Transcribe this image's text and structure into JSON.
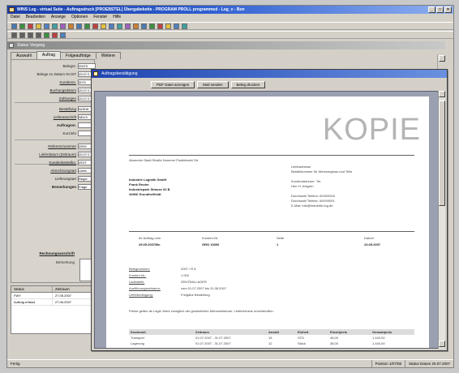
{
  "app": {
    "title": "WINS Log - virtual Suite - Auftragsdruck [PROEBSTEL] Übergabekette - PROGRAM PROLL programmed - Log_v - Bon",
    "menu": [
      "Datei",
      "Bearbeiten",
      "Anzeige",
      "Optionen",
      "Fenster",
      "Hilfe"
    ]
  },
  "doc_window": {
    "title": "Status Vorgang",
    "tabs": [
      "Auswahl",
      "Auftrag",
      "Folgeaufträge",
      "Weitere"
    ],
    "active_tab": 1
  },
  "form": {
    "fields": [
      {
        "label": "Belegnr.",
        "value": "20070",
        "style": "normal"
      },
      {
        "label": "Belege zu Datum IN IST",
        "value": "29.07.0",
        "style": "normal"
      },
      {
        "label": "Kundennr.",
        "value": "3070",
        "style": "link"
      },
      {
        "label": "Buchungsdatum",
        "value": "20.07.0",
        "style": "link"
      },
      {
        "label": "Zahlungen",
        "value": "20.07.0",
        "style": "link"
      },
      {
        "label": "Bestellung",
        "value": "NOEW",
        "style": "link"
      },
      {
        "label": "Lieferanschrift",
        "value": "NEU3",
        "style": "link"
      },
      {
        "label": "Auftragsnr.",
        "value": "",
        "style": "bold"
      },
      {
        "label": "Kurzinfo",
        "value": "",
        "style": "normal"
      },
      {
        "label": "Referenznummer",
        "value": "ZE09",
        "style": "link"
      },
      {
        "label": "Lieferdatum (Zeitraum)",
        "value": "20.07.0",
        "style": "link"
      },
      {
        "label": "Kundenbestellnr.",
        "value": "ZE3T",
        "style": "link"
      },
      {
        "label": "Abrechnungsart",
        "value": "Liefer",
        "style": "link"
      },
      {
        "label": "Lieferungsart",
        "value": "Regel",
        "style": "normal"
      },
      {
        "label": "Bemerkungen",
        "value": "Frage",
        "style": "bold"
      }
    ],
    "memo_label": "Rechnungsanschrift",
    "memo_sublabel": "Bemerkung"
  },
  "grid": {
    "columns": [
      "Status",
      "Zeitraum"
    ],
    "rows": [
      [
        "FWY",
        "27.05.2007"
      ],
      [
        "Auftrag erfasst",
        "27.06.2007"
      ]
    ]
  },
  "dialog": {
    "title": "Auftragsbestätigung",
    "buttons": [
      "PDF Datei anzeigen",
      "Mail senden",
      "Beleg drucken"
    ]
  },
  "document": {
    "stamp": "KOPIE",
    "sender_line": "Absender Stadt Straße Nummer Postleitzahl Ort",
    "recipient": {
      "company": "Industrie Logistik GmbH",
      "person": "Frank Reuter",
      "street": "Industriepark Strasse 32 B",
      "city": "34966 Grundheilfeldt"
    },
    "right_block": [
      "Lieferadresse",
      "Bestellnummer für Werkzeugbau und Teile",
      "",
      "Kundenbetreuer: Tel.",
      "Herr H. Ahlgren",
      "",
      "Durchwahl Telefon: 0049/0000",
      "Durchwahl Telefax: 0049/0001",
      "E-Mail: info@industrie-log.de"
    ],
    "info_headers": [
      "Ihr Auftrag vom",
      "Kunden-Nr.",
      "Seite",
      "Datum"
    ],
    "info_values": [
      "29.05.2007/Bn",
      "GRG 10000",
      "1",
      "23.05.2007"
    ],
    "details": [
      {
        "label": "Belegnummer:",
        "value": "2007 / R 8"
      },
      {
        "label": "Kunden-Nr.:",
        "value": "1 000"
      },
      {
        "label": "Ladestelle:",
        "value": "ZENTRALLAGER"
      },
      {
        "label": "Ausführungszeitraum:",
        "value": "vom 01.07.2007 bis 31.08.2007"
      },
      {
        "label": "Lieferbedingung:",
        "value": "Freigabe Bestellung"
      }
    ],
    "note": "Preise gelten ab Lager Werk zuzüglich der gesetzlichen Mehrwertsteuer. Liefertermine unverbindlich.",
    "table": {
      "headers": [
        "Kostenart",
        "Zeitraum",
        "Anzahl",
        "Einheit",
        "Einzelpreis",
        "Gesamtpreis"
      ],
      "rows": [
        [
          "Transport",
          "01.07.2007 - 31.07.2007",
          "15",
          "STD",
          "48,00",
          "1.440,00"
        ],
        [
          "Lagerung",
          "01.07.2007 - 31.07.2007",
          "12",
          "Stück",
          "38,00",
          "1.440,00"
        ]
      ]
    }
  },
  "statusbar": {
    "left": "Fertig",
    "cells": [
      "Position 1/07/08",
      "Status Datum 20.07.2007"
    ]
  },
  "colors": {
    "titlebar": "#1a3fa8",
    "dialog_title": "#1e44b0",
    "window_bg": "#d4d0c8",
    "page_bg": "#9aa0b0",
    "stamp": "#b4b4b4"
  }
}
